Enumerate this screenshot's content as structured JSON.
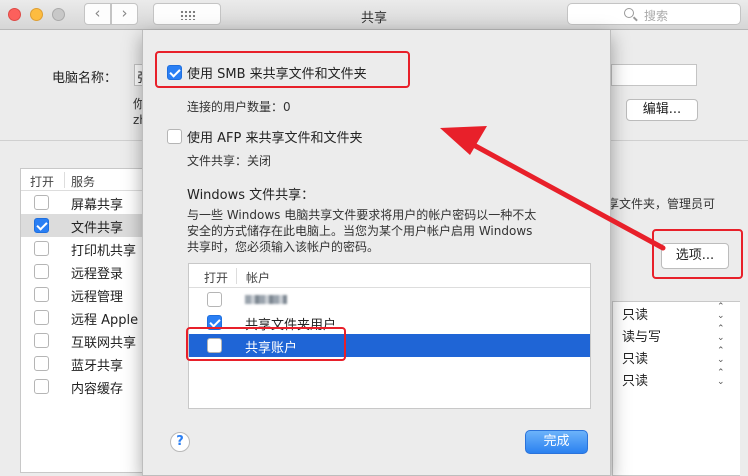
{
  "window": {
    "title": "共享",
    "search_placeholder": "搜索"
  },
  "background": {
    "computer_name_label": "电脑名称：",
    "computer_name_value": "张",
    "sub_line1": "你",
    "sub_line2": "zh",
    "edit_button": "编辑...",
    "services_header": {
      "open": "打开",
      "service": "服务"
    },
    "services": [
      {
        "label": "屏幕共享",
        "checked": false,
        "selected": false
      },
      {
        "label": "文件共享",
        "checked": true,
        "selected": true
      },
      {
        "label": "打印机共享",
        "checked": false,
        "selected": false
      },
      {
        "label": "远程登录",
        "checked": false,
        "selected": false
      },
      {
        "label": "远程管理",
        "checked": false,
        "selected": false
      },
      {
        "label": "远程 Apple",
        "checked": false,
        "selected": false
      },
      {
        "label": "互联网共享",
        "checked": false,
        "selected": false
      },
      {
        "label": "蓝牙共享",
        "checked": false,
        "selected": false
      },
      {
        "label": "内容缓存",
        "checked": false,
        "selected": false
      }
    ],
    "right_desc": "享文件夹，管理员可",
    "options_button": "选项...",
    "permissions": [
      "只读",
      "读与写",
      "只读",
      "只读"
    ]
  },
  "sheet": {
    "smb_label": "使用 SMB 来共享文件和文件夹",
    "smb_checked": true,
    "connected_users": "连接的用户数量：0",
    "afp_label": "使用 AFP 来共享文件和文件夹",
    "afp_checked": false,
    "afp_status": "文件共享：关闭",
    "windows_title": "Windows 文件共享：",
    "windows_desc_line1": "与一些 Windows 电脑共享文件要求将用户的帐户密码以一种不太",
    "windows_desc_line2": "安全的方式储存在此电脑上。当您为某个用户帐户启用 Windows",
    "windows_desc_line3": "共享时，您必须输入该帐户的密码。",
    "table_header": {
      "open": "打开",
      "account": "帐户"
    },
    "accounts": [
      {
        "name": "",
        "checked": false,
        "selected": false
      },
      {
        "name": "共享文件夹用户",
        "checked": true,
        "selected": false
      },
      {
        "name": "共享账户",
        "checked": false,
        "selected": true
      }
    ],
    "help_label": "?",
    "done_button": "完成"
  },
  "colors": {
    "accent": "#2a7ff4",
    "selection": "#1f65d6",
    "annotation": "#e8202a"
  }
}
